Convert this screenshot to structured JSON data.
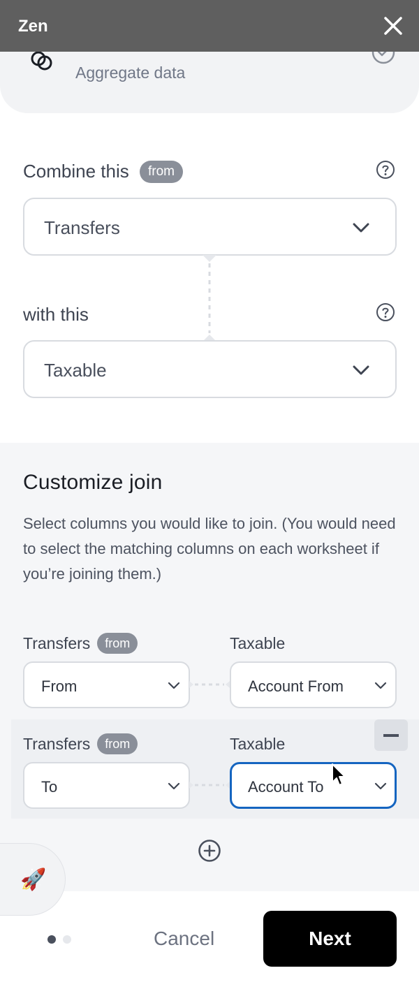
{
  "titlebar": {
    "title": "Zen",
    "close_icon": "close-icon"
  },
  "top_card": {
    "label": "Aggregate data",
    "icon": "link-rings-icon",
    "status_icon": "check-circle-icon"
  },
  "combine": {
    "label": "Combine this",
    "badge": "from",
    "value": "Transfers"
  },
  "with_this": {
    "label": "with this",
    "value": "Taxable"
  },
  "customize": {
    "title": "Customize join",
    "description": "Select columns you would like to join. (You would need to select the matching columns on each worksheet if you’re joining them.)",
    "rows": [
      {
        "left_table": "Transfers",
        "left_badge": "from",
        "left_value": "From",
        "right_table": "Taxable",
        "right_value": "Account From"
      },
      {
        "left_table": "Transfers",
        "left_badge": "from",
        "left_value": "To",
        "right_table": "Taxable",
        "right_value": "Account To"
      }
    ]
  },
  "footer": {
    "cancel_label": "Cancel",
    "next_label": "Next",
    "page_count": 2,
    "current_page": 1
  },
  "colors": {
    "accent": "#1565c0",
    "header": "#5f5f5f",
    "badge": "#8a8f99",
    "primary_button": "#000000"
  }
}
